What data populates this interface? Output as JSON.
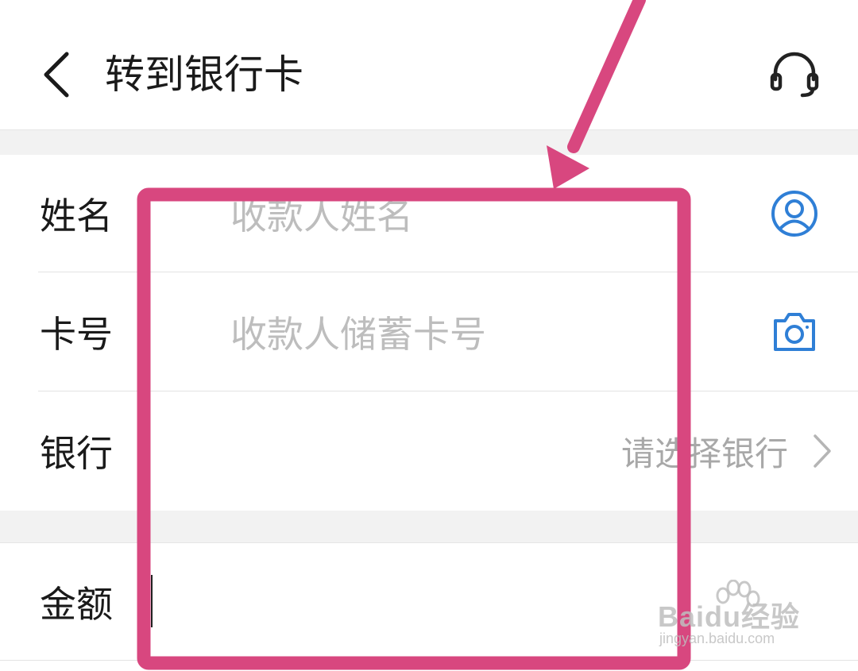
{
  "header": {
    "title": "转到银行卡",
    "back_icon": "chevron-left-icon",
    "service_icon": "headset-icon"
  },
  "form": {
    "name": {
      "label": "姓名",
      "placeholder": "收款人姓名",
      "icon": "contact-person-icon"
    },
    "card": {
      "label": "卡号",
      "placeholder": "收款人储蓄卡号",
      "icon": "camera-icon"
    },
    "bank": {
      "label": "银行",
      "select_hint": "请选择银行",
      "icon": "chevron-right-icon"
    },
    "amount": {
      "label": "金额",
      "value": ""
    }
  },
  "annotation": {
    "color": "#d8477f",
    "shapes": [
      "arrow",
      "rectangle-highlight"
    ]
  },
  "watermark": {
    "brand": "Baidu经验",
    "url": "jingyan.baidu.com"
  },
  "colors": {
    "accent_blue": "#2f7fd6",
    "placeholder_gray": "#bdbdbd",
    "section_bg": "#f2f2f2"
  }
}
